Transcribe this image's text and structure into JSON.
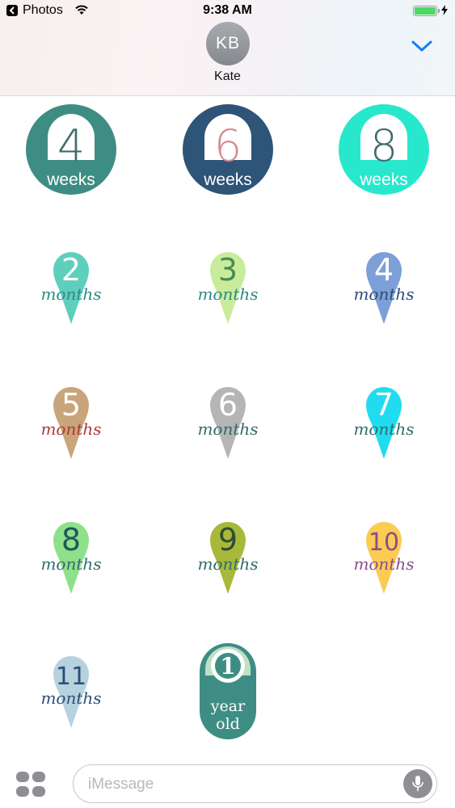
{
  "status_bar": {
    "back_app": "Photos",
    "time": "9:38 AM"
  },
  "contact": {
    "initials": "KB",
    "name": "Kate"
  },
  "stickers": [
    {
      "kind": "circle",
      "number": "4",
      "label": "weeks",
      "color": "#3e8d84",
      "number_color": "#3e6e6a"
    },
    {
      "kind": "circle",
      "number": "6",
      "label": "weeks",
      "color": "#2e5478",
      "number_color": "#d98a93"
    },
    {
      "kind": "circle",
      "number": "8",
      "label": "weeks",
      "color": "#27e8cc",
      "number_color": "#3e6e6a"
    },
    {
      "kind": "pin",
      "number": "2",
      "label": "months",
      "color": "#5ecfbd",
      "number_color": "#ffffff",
      "label_color": "#2f8a83"
    },
    {
      "kind": "pin",
      "number": "3",
      "label": "months",
      "color": "#c9ec9c",
      "number_color": "#4a8a55",
      "label_color": "#2f8a83"
    },
    {
      "kind": "pin",
      "number": "4",
      "label": "months",
      "color": "#7d9fd8",
      "number_color": "#ffffff",
      "label_color": "#2d4d7a"
    },
    {
      "kind": "pin",
      "number": "5",
      "label": "months",
      "color": "#c8a57a",
      "number_color": "#ffffff",
      "label_color": "#b23838"
    },
    {
      "kind": "pin",
      "number": "6",
      "label": "months",
      "color": "#b5b5b5",
      "number_color": "#ffffff",
      "label_color": "#2f6e6a"
    },
    {
      "kind": "pin",
      "number": "7",
      "label": "months",
      "color": "#20dcee",
      "number_color": "#ffffff",
      "label_color": "#2f6e6a"
    },
    {
      "kind": "pin",
      "number": "8",
      "label": "months",
      "color": "#8fe08a",
      "number_color": "#1e5a5a",
      "label_color": "#2f6e6a"
    },
    {
      "kind": "pin",
      "number": "9",
      "label": "months",
      "color": "#a8b83a",
      "number_color": "#2f4f2f",
      "label_color": "#2f6e6a"
    },
    {
      "kind": "pin",
      "number": "10",
      "label": "months",
      "color": "#fbcb54",
      "number_color": "#8a4f8a",
      "label_color": "#8a4f8a"
    },
    {
      "kind": "pin",
      "number": "11",
      "label": "months",
      "color": "#b7d2df",
      "number_color": "#2d4d7a",
      "label_color": "#2d4d7a"
    },
    {
      "kind": "year",
      "number": "1",
      "label_line1": "year",
      "label_line2": "old",
      "color": "#3e8d84",
      "number_color": "#3e8d84"
    }
  ],
  "compose": {
    "placeholder": "iMessage"
  }
}
